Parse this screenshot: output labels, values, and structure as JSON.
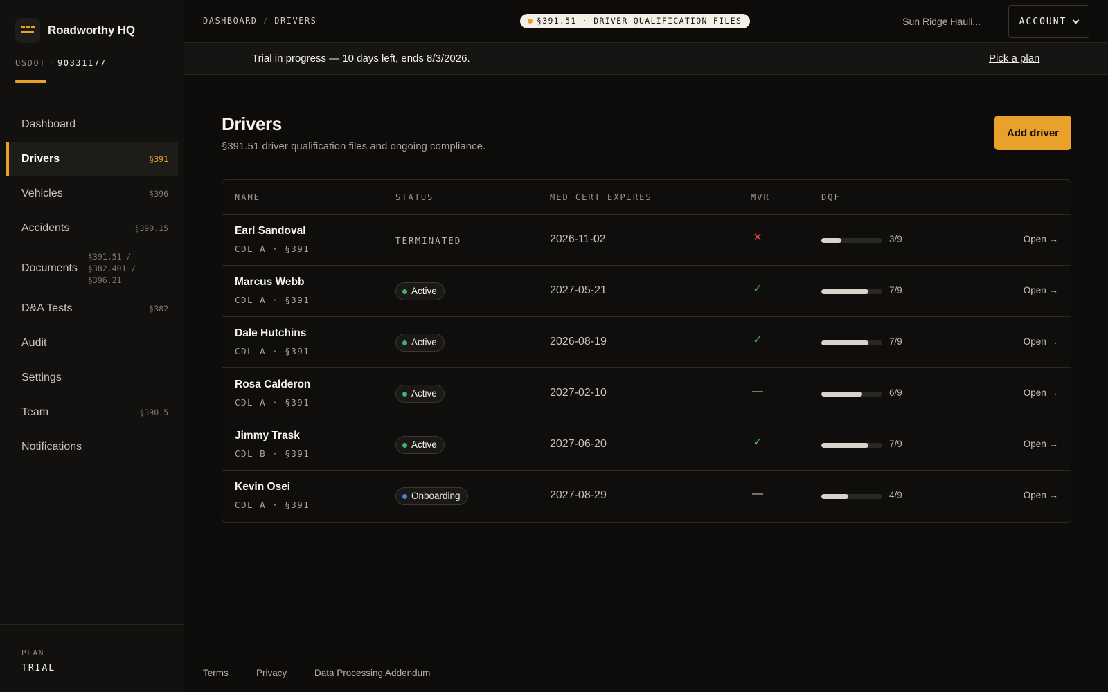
{
  "brand": {
    "name": "Roadworthy HQ",
    "logo_icon": "truck-grille-icon",
    "accent": "#e9a12b"
  },
  "usdot": {
    "label": "USDOT",
    "separator": "·",
    "number": "90331177"
  },
  "sidebar": {
    "items": [
      {
        "label": "Dashboard",
        "ref": ""
      },
      {
        "label": "Drivers",
        "ref": "§391"
      },
      {
        "label": "Vehicles",
        "ref": "§396"
      },
      {
        "label": "Accidents",
        "ref": "§390.15"
      },
      {
        "label": "Documents",
        "ref_lines": [
          "§391.51 /",
          "§382.401 /",
          "§396.21"
        ]
      },
      {
        "label": "D&A Tests",
        "ref": "§382"
      },
      {
        "label": "Audit",
        "ref": ""
      },
      {
        "label": "Settings",
        "ref": ""
      },
      {
        "label": "Team",
        "ref": "§390.5"
      },
      {
        "label": "Notifications",
        "ref": ""
      }
    ],
    "active_index": 1
  },
  "plan": {
    "label": "PLAN",
    "value": "TRIAL"
  },
  "header": {
    "breadcrumb": [
      "DASHBOARD",
      "DRIVERS"
    ],
    "breadcrumb_sep": "/",
    "pill": "§391.51 · DRIVER QUALIFICATION FILES",
    "org": "Sun Ridge Hauli...",
    "account_label": "ACCOUNT"
  },
  "trial": {
    "text": "Trial in progress — 10 days left, ends 8/3/2026.",
    "link": "Pick a plan"
  },
  "page": {
    "title": "Drivers",
    "subtitle": "§391.51 driver qualification files and ongoing compliance.",
    "add_button": "Add driver"
  },
  "table": {
    "headers": [
      "NAME",
      "STATUS",
      "MED CERT EXPIRES",
      "MVR",
      "DQF"
    ],
    "rows": [
      {
        "name": "Earl Sandoval",
        "cdl": "CDL A · §391",
        "status": "TERMINATED",
        "status_kind": "text",
        "med_cert": "2026-11-02",
        "mvr": "fail",
        "mvr_glyph": "✕",
        "dqf_done": 3,
        "dqf_total": 9,
        "dqf_label": "3/9",
        "action": "Open →"
      },
      {
        "name": "Marcus Webb",
        "cdl": "CDL A · §391",
        "status": "Active",
        "status_kind": "active",
        "med_cert": "2027-05-21",
        "mvr": "pass",
        "mvr_glyph": "✓",
        "dqf_done": 7,
        "dqf_total": 9,
        "dqf_label": "7/9",
        "action": "Open →"
      },
      {
        "name": "Dale Hutchins",
        "cdl": "CDL A · §391",
        "status": "Active",
        "status_kind": "active",
        "med_cert": "2026-08-19",
        "mvr": "pass",
        "mvr_glyph": "✓",
        "dqf_done": 7,
        "dqf_total": 9,
        "dqf_label": "7/9",
        "action": "Open →"
      },
      {
        "name": "Rosa Calderon",
        "cdl": "CDL A · §391",
        "status": "Active",
        "status_kind": "active",
        "med_cert": "2027-02-10",
        "mvr": "none",
        "mvr_glyph": "—",
        "dqf_done": 6,
        "dqf_total": 9,
        "dqf_label": "6/9",
        "action": "Open →"
      },
      {
        "name": "Jimmy Trask",
        "cdl": "CDL B · §391",
        "status": "Active",
        "status_kind": "active",
        "med_cert": "2027-06-20",
        "mvr": "pass",
        "mvr_glyph": "✓",
        "dqf_done": 7,
        "dqf_total": 9,
        "dqf_label": "7/9",
        "action": "Open →"
      },
      {
        "name": "Kevin Osei",
        "cdl": "CDL A · §391",
        "status": "Onboarding",
        "status_kind": "onboarding",
        "med_cert": "2027-08-29",
        "mvr": "none",
        "mvr_glyph": "—",
        "dqf_done": 4,
        "dqf_total": 9,
        "dqf_label": "4/9",
        "action": "Open →"
      }
    ]
  },
  "status_colors": {
    "active": "#3fb56a",
    "onboarding": "#4a7fd6"
  },
  "footer": {
    "links": [
      "Terms",
      "Privacy",
      "Data Processing Addendum"
    ],
    "separator": "·"
  }
}
